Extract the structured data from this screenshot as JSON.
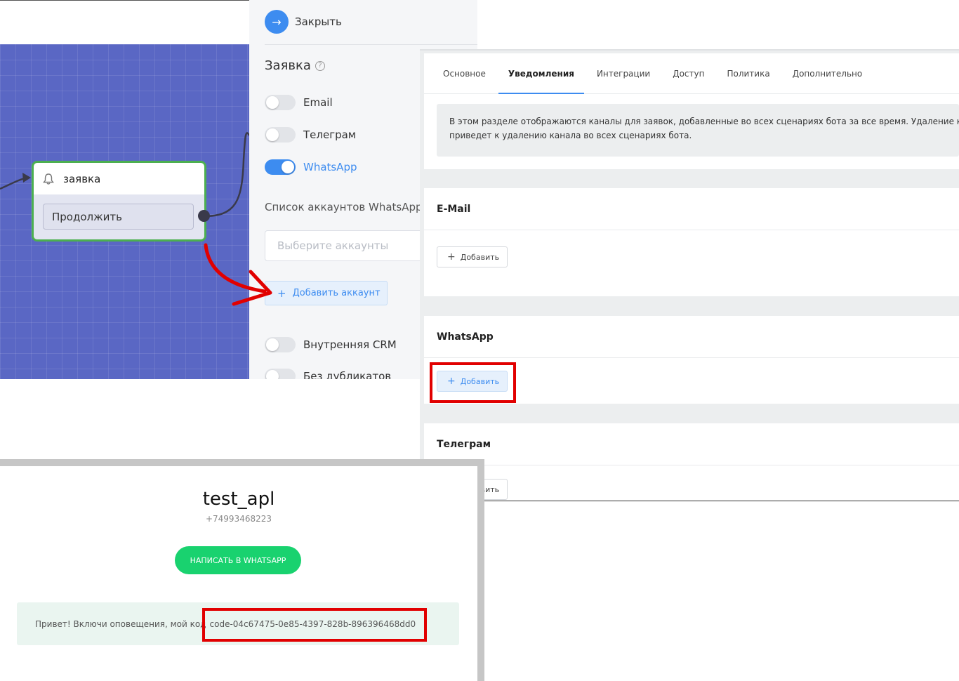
{
  "flow_editor": {
    "node_title": "заявка",
    "node_button": "Продолжить"
  },
  "side_panel": {
    "close_label": "Закрыть",
    "title": "Заявка",
    "toggles": [
      {
        "label": "Email",
        "on": false
      },
      {
        "label": "Телеграм",
        "on": false
      },
      {
        "label": "WhatsApp",
        "on": true
      },
      {
        "label": "Внутренняя CRM",
        "on": false
      },
      {
        "label": "Без дубликатов",
        "on": false
      }
    ],
    "whatsapp_accounts_label": "Список аккаунтов WhatsApp",
    "accounts_placeholder": "Выберите аккаунты",
    "add_account_label": "Добавить аккаунт"
  },
  "bot_settings": {
    "tabs": [
      {
        "label": "Основное",
        "active": false
      },
      {
        "label": "Уведомления",
        "active": true
      },
      {
        "label": "Интеграции",
        "active": false
      },
      {
        "label": "Доступ",
        "active": false
      },
      {
        "label": "Политика",
        "active": false
      },
      {
        "label": "Дополнительно",
        "active": false
      }
    ],
    "info_line1": "В этом разделе отображаются каналы для заявок, добавленные во всех сценариях бота за все время. Удаление канала",
    "info_line2": "приведет к удалению канала во всех сценариях бота.",
    "sections": [
      {
        "title": "E-Mail",
        "add_label": "Добавить"
      },
      {
        "title": "WhatsApp",
        "add_label": "Добавить"
      },
      {
        "title": "Телеграм",
        "add_label": "Добавить"
      }
    ]
  },
  "bot_profile": {
    "name": "test_apl",
    "phone": "+74993468223",
    "write_button": "НАПИСАТЬ В WHATSAPP",
    "message_prefix": "Привет! Включи оповещения, мой код",
    "message_code": "code-04c67475-0e85-4397-828b-896396468dd0"
  },
  "colors": {
    "canvas_bg": "#5a67c4",
    "accent_blue": "#3d8cf0",
    "node_border": "#4caf50",
    "whatsapp_green": "#19d26f",
    "annotation_red": "#e10000"
  }
}
